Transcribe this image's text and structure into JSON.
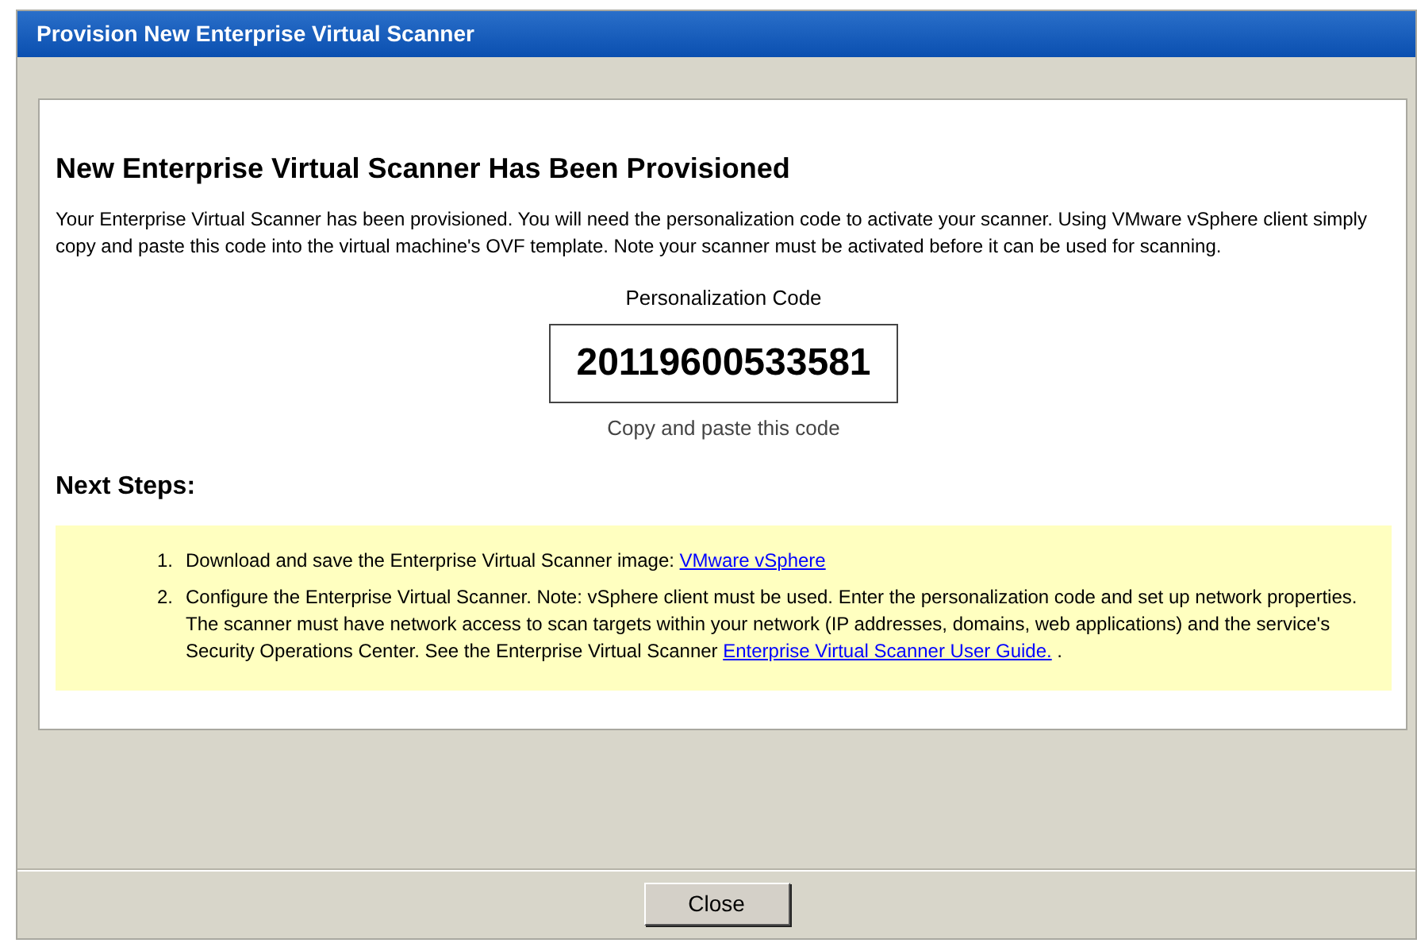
{
  "window": {
    "title": "Provision New Enterprise Virtual Scanner"
  },
  "heading": "New Enterprise Virtual Scanner Has Been Provisioned",
  "intro": "Your Enterprise Virtual Scanner has been provisioned. You will need the personalization code to activate your scanner. Using VMware vSphere client simply copy and paste this code into the virtual machine's OVF template. Note your scanner must be activated before it can be used for scanning.",
  "code": {
    "label": "Personalization Code",
    "value": "20119600533581",
    "hint": "Copy and paste this code"
  },
  "next_steps": {
    "title": "Next Steps:",
    "items": [
      {
        "number": "1.",
        "text": "Download and save the Enterprise Virtual Scanner image:",
        "link": "VMware vSphere"
      },
      {
        "number": "2.",
        "text": "Configure the Enterprise Virtual Scanner. Note: vSphere client must be used. Enter the personalization code and set up network properties. The scanner must have network access to scan targets within your network (IP addresses, domains, web applications) and the service's Security Operations Center. See the Enterprise Virtual Scanner",
        "link": "Enterprise Virtual Scanner User Guide.",
        "tail": "."
      }
    ]
  },
  "buttons": [
    "Close"
  ]
}
